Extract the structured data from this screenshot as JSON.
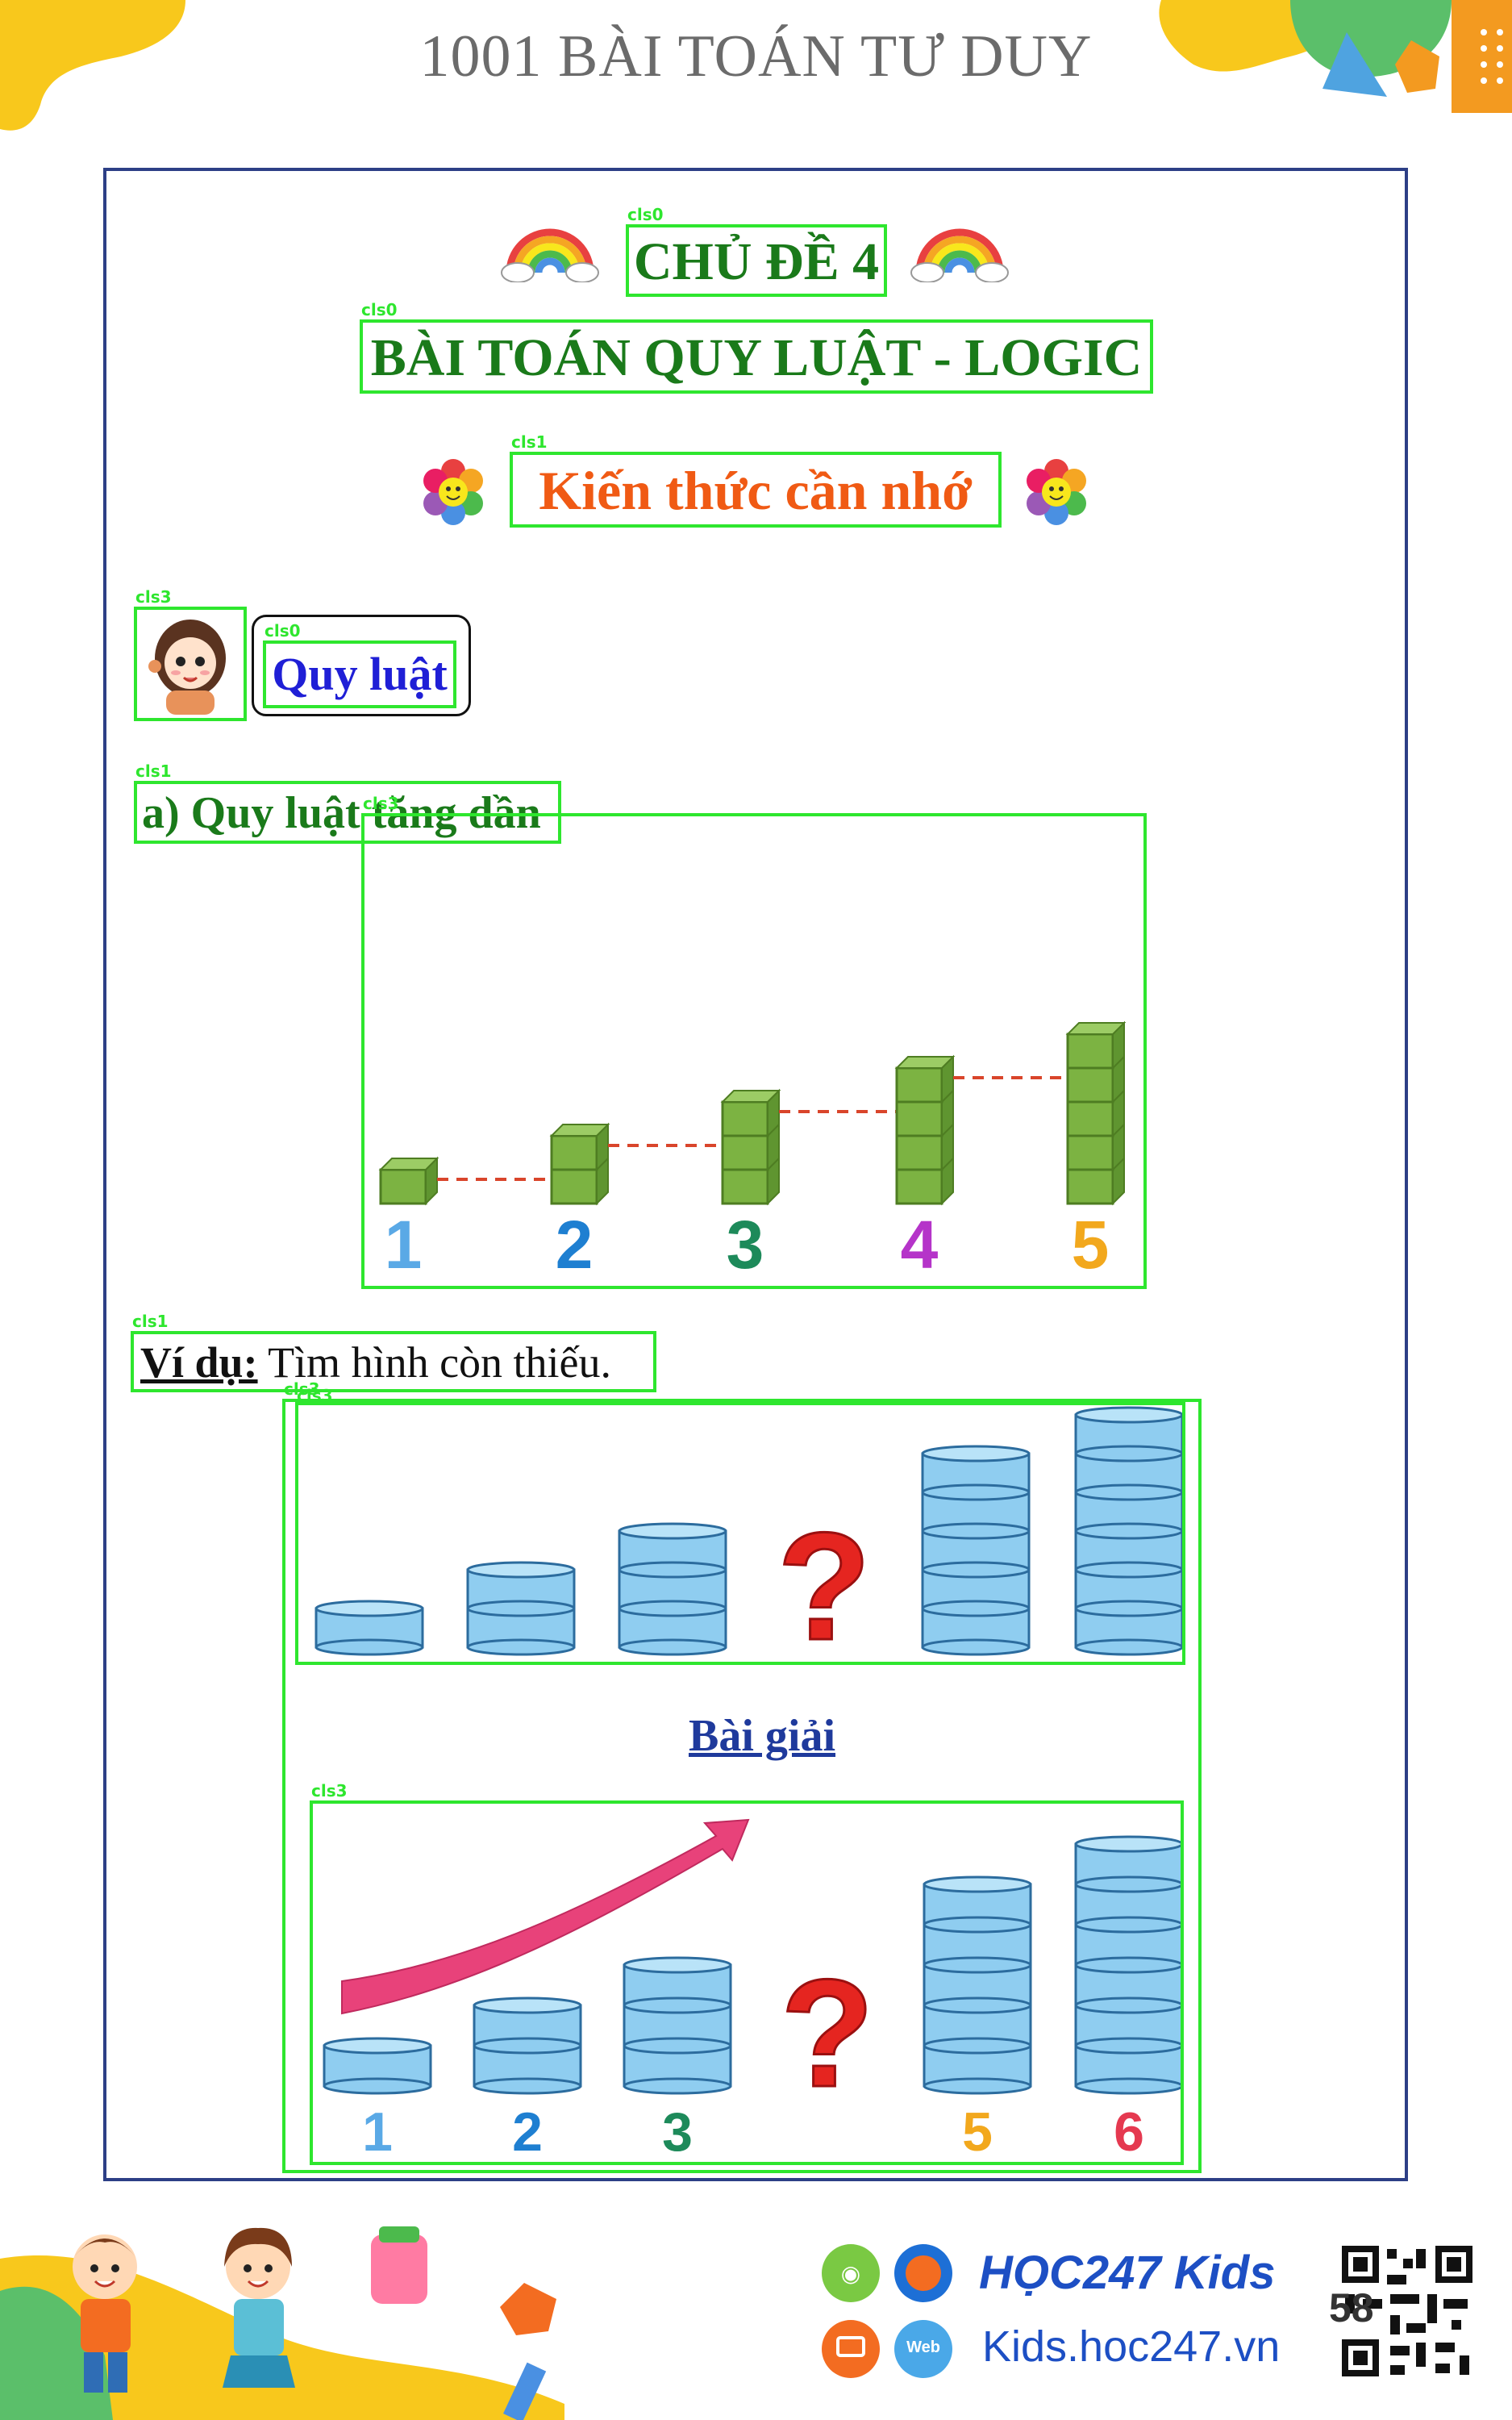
{
  "header": {
    "title": "1001 BÀI TOÁN TƯ DUY"
  },
  "chapter": {
    "label": "CHỦ ĐỀ 4",
    "subtitle": "BÀI TOÁN QUY LUẬT - LOGIC"
  },
  "knowledge": {
    "heading": "Kiến thức cần nhớ"
  },
  "rule": {
    "heading": "Quy luật"
  },
  "section_a": {
    "heading": "a) Quy luật tăng dần"
  },
  "cube_figure": {
    "numbers": [
      "1",
      "2",
      "3",
      "4",
      "5"
    ]
  },
  "example": {
    "label": "Ví dụ:",
    "text": " Tìm hình còn thiếu."
  },
  "solution": {
    "heading": "Bài giải",
    "numbers": [
      "1",
      "2",
      "3",
      "5",
      "6"
    ]
  },
  "annotations": {
    "cls0": "cls0",
    "cls1": "cls1",
    "cls3": "cls3"
  },
  "footer": {
    "brand": "HỌC247 Kids",
    "url": "Kids.hoc247.vn",
    "web_badge": "Web",
    "page_number": "58"
  }
}
